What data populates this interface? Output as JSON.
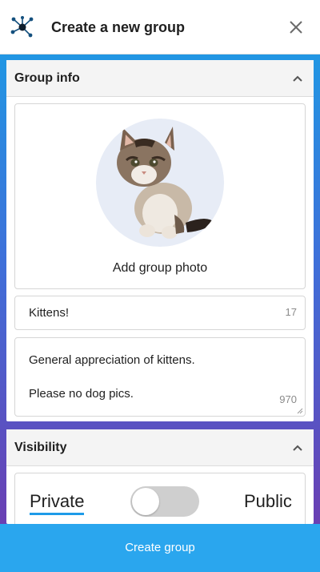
{
  "header": {
    "title": "Create a new group",
    "logo_icon": "network-hub-icon",
    "close_icon": "close-icon"
  },
  "colors": {
    "accent": "#2aa6ee",
    "gradient_top": "#2196e3",
    "gradient_bottom": "#6a3fb3"
  },
  "group_info": {
    "title": "Group info",
    "collapse_icon": "chevron-up-icon",
    "photo_label": "Add group photo",
    "photo_subject": "kitten-photo",
    "name_value": "Kittens!",
    "name_remaining": "17",
    "description_line1": "General appreciation of kittens.",
    "description_line2": "Please no dog pics.",
    "description_remaining": "970"
  },
  "visibility": {
    "title": "Visibility",
    "collapse_icon": "chevron-up-icon",
    "private_label": "Private",
    "public_label": "Public",
    "is_public": false
  },
  "footer": {
    "create_label": "Create group"
  }
}
